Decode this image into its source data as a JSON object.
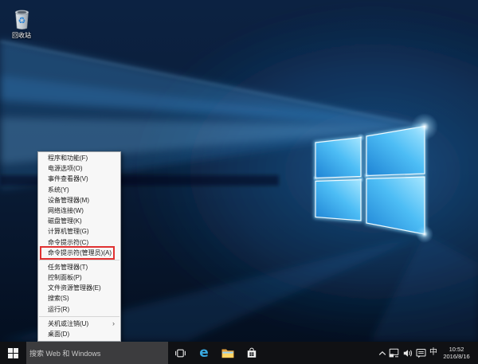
{
  "desktop": {
    "recycle_bin": {
      "label": "回收站"
    }
  },
  "context_menu": {
    "highlight_color": "#e03131",
    "items": [
      {
        "id": "programs-and-features",
        "label": "程序和功能(F)"
      },
      {
        "id": "power-options",
        "label": "电源选项(O)"
      },
      {
        "id": "event-viewer",
        "label": "事件查看器(V)"
      },
      {
        "id": "system",
        "label": "系统(Y)"
      },
      {
        "id": "device-manager",
        "label": "设备管理器(M)"
      },
      {
        "id": "network-connections",
        "label": "网络连接(W)"
      },
      {
        "id": "disk-management",
        "label": "磁盘管理(K)"
      },
      {
        "id": "computer-management",
        "label": "计算机管理(G)"
      },
      {
        "id": "command-prompt",
        "label": "命令提示符(C)"
      },
      {
        "id": "command-prompt-admin",
        "label": "命令提示符(管理员)(A)",
        "highlighted": true
      },
      {
        "type": "separator"
      },
      {
        "id": "task-manager",
        "label": "任务管理器(T)"
      },
      {
        "id": "control-panel",
        "label": "控制面板(P)"
      },
      {
        "id": "file-explorer",
        "label": "文件资源管理器(E)"
      },
      {
        "id": "search",
        "label": "搜索(S)"
      },
      {
        "id": "run",
        "label": "运行(R)"
      },
      {
        "type": "separator"
      },
      {
        "id": "shutdown-or-signout",
        "label": "关机或注销(U)",
        "submenu": true
      },
      {
        "id": "desktop",
        "label": "桌面(D)"
      }
    ]
  },
  "taskbar": {
    "search": {
      "placeholder": "搜索 Web 和 Windows"
    },
    "tray": {
      "ime_indicator": "中",
      "time": "10:52",
      "date": "2016/8/16"
    }
  }
}
